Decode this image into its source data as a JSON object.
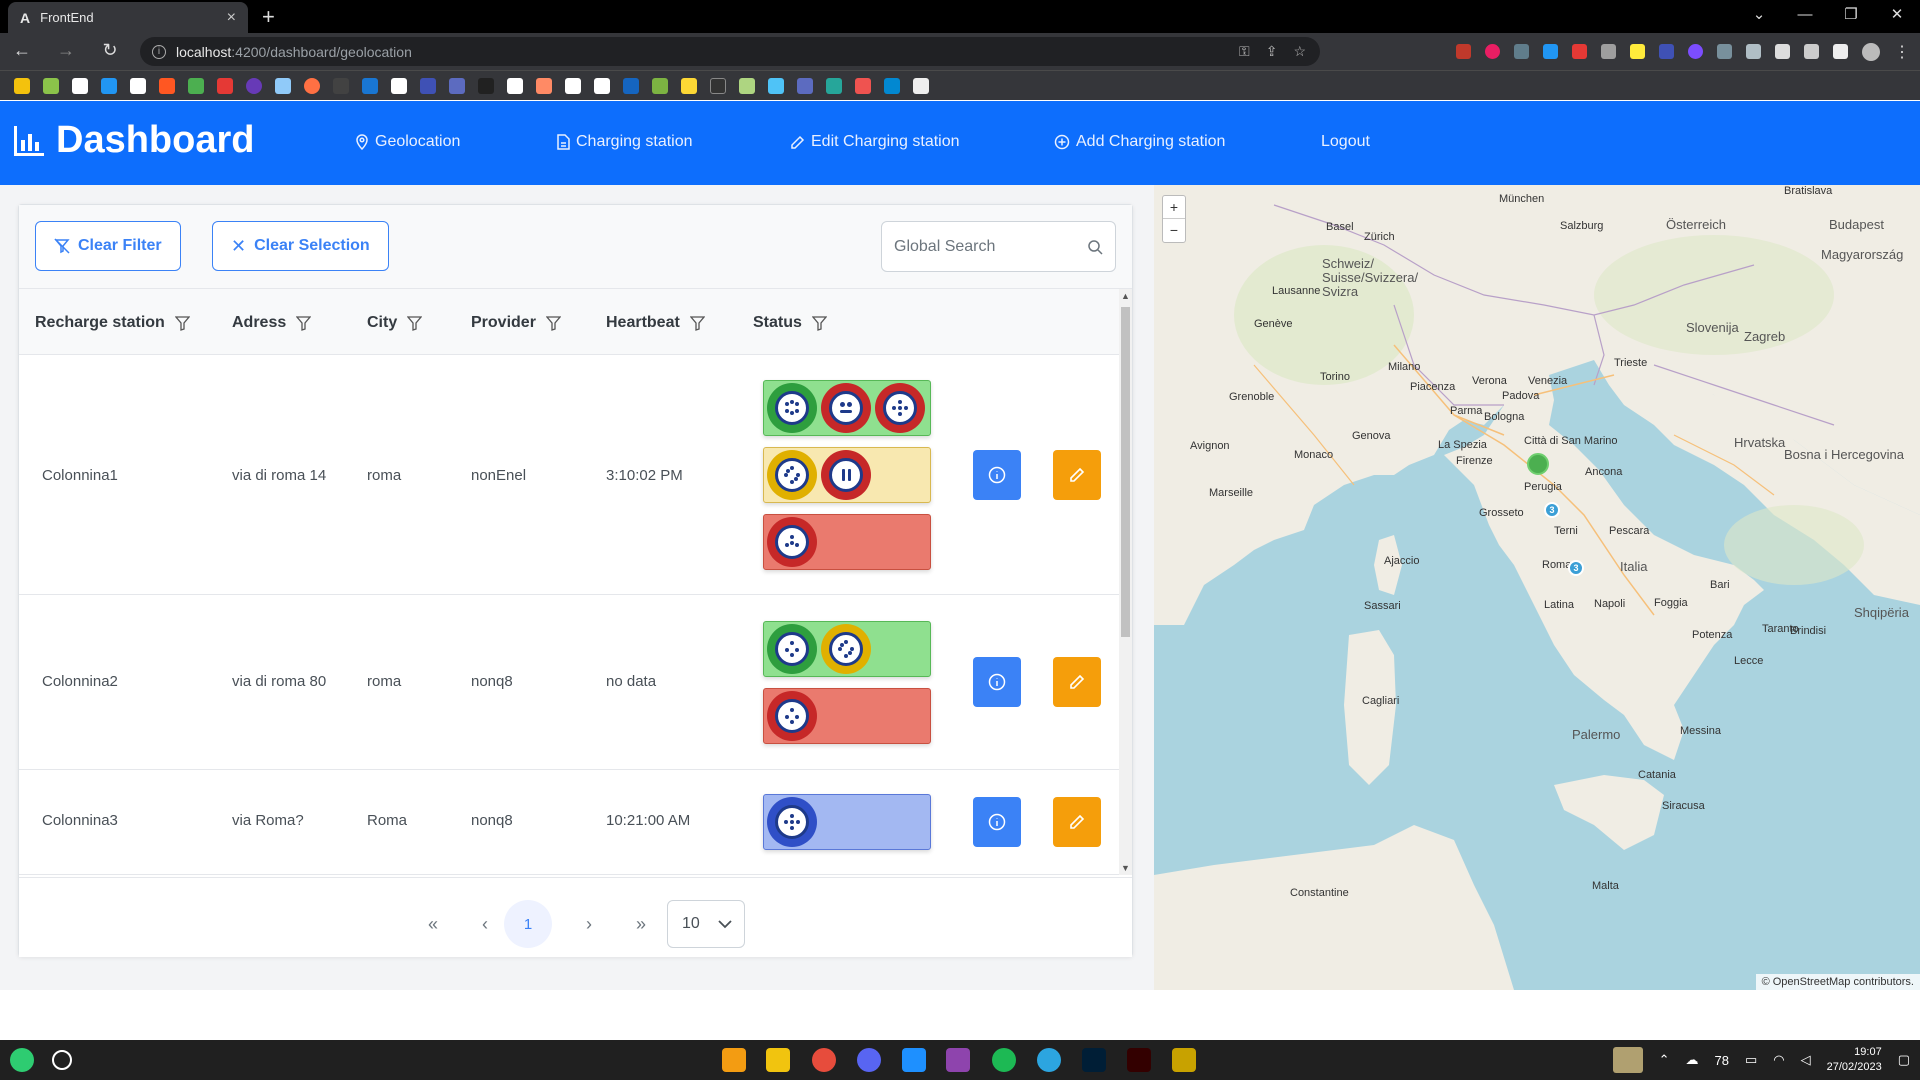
{
  "browser": {
    "tab_title": "FrontEnd",
    "url_host": "localhost",
    "url_path": ":4200/dashboard/geolocation"
  },
  "app": {
    "brand": "Dashboard",
    "nav": [
      {
        "label": "Geolocation",
        "icon": "map-pin-icon"
      },
      {
        "label": "Charging station",
        "icon": "document-icon"
      },
      {
        "label": "Edit Charging station",
        "icon": "pencil-icon"
      },
      {
        "label": "Add Charging station",
        "icon": "plus-circle-icon"
      },
      {
        "label": "Logout",
        "icon": ""
      }
    ],
    "colors": {
      "primary": "#0d6efd",
      "info": "#3b82f6",
      "edit": "#f59e0b",
      "green": "#8fe08f",
      "yellow": "#f8e8b0",
      "red": "#ea7a6e",
      "blue": "#a3b8f2"
    }
  },
  "toolbar": {
    "clear_filter": "Clear Filter",
    "clear_selection": "Clear Selection",
    "search_placeholder": "Global Search"
  },
  "table": {
    "columns": [
      "Recharge station",
      "Adress",
      "City",
      "Provider",
      "Heartbeat",
      "Status"
    ],
    "rows": [
      {
        "station": "Colonnina1",
        "address": "via di roma 14",
        "city": "roma",
        "provider": "nonEnel",
        "heartbeat": "3:10:02 PM"
      },
      {
        "station": "Colonnina2",
        "address": "via di roma 80",
        "city": "roma",
        "provider": "nonq8",
        "heartbeat": "no data"
      },
      {
        "station": "Colonnina3",
        "address": "via Roma?",
        "city": "Roma",
        "provider": "nonq8",
        "heartbeat": "10:21:00 AM"
      }
    ]
  },
  "pagination": {
    "current_page": "1",
    "rows_per_page": "10"
  },
  "map": {
    "attribution": "© OpenStreetMap contributors.",
    "zoom_in": "+",
    "zoom_out": "−",
    "cluster_1": "3",
    "cluster_2": "3",
    "labels": [
      "Bratislava",
      "Budapest",
      "Österreich",
      "Magyarország",
      "Schweiz/ Suisse/Svizzera/ Svizra",
      "Slovenija",
      "Zagreb",
      "Hrvatska",
      "Bosna i Hercegovina",
      "Venezia",
      "Trieste",
      "Bologna",
      "Firenze",
      "Monaco",
      "Genova",
      "Marseille",
      "Perugia",
      "Italia",
      "Roma",
      "Napoli",
      "Bari",
      "Palermo",
      "Catania",
      "Messina",
      "Cagliari",
      "Sassari",
      "Ajaccio",
      "Avignon",
      "Grenoble",
      "Lausanne",
      "Genève",
      "Zürich",
      "Basel",
      "München",
      "Salzburg",
      "Ancona",
      "Foggia",
      "Taranto",
      "Potenza",
      "Latina",
      "Milano",
      "Torino",
      "Verona",
      "Padova",
      "Parma",
      "Piacenza",
      "La Spezia",
      "Grosseto",
      "Terni",
      "Pescara",
      "Constantine",
      "Malta",
      "Siracusa",
      "Lecce",
      "Brindisi",
      "Shqipëria",
      "Città di San Marino"
    ]
  },
  "taskbar": {
    "battery": "78",
    "time": "19:07",
    "date": "27/02/2023"
  }
}
